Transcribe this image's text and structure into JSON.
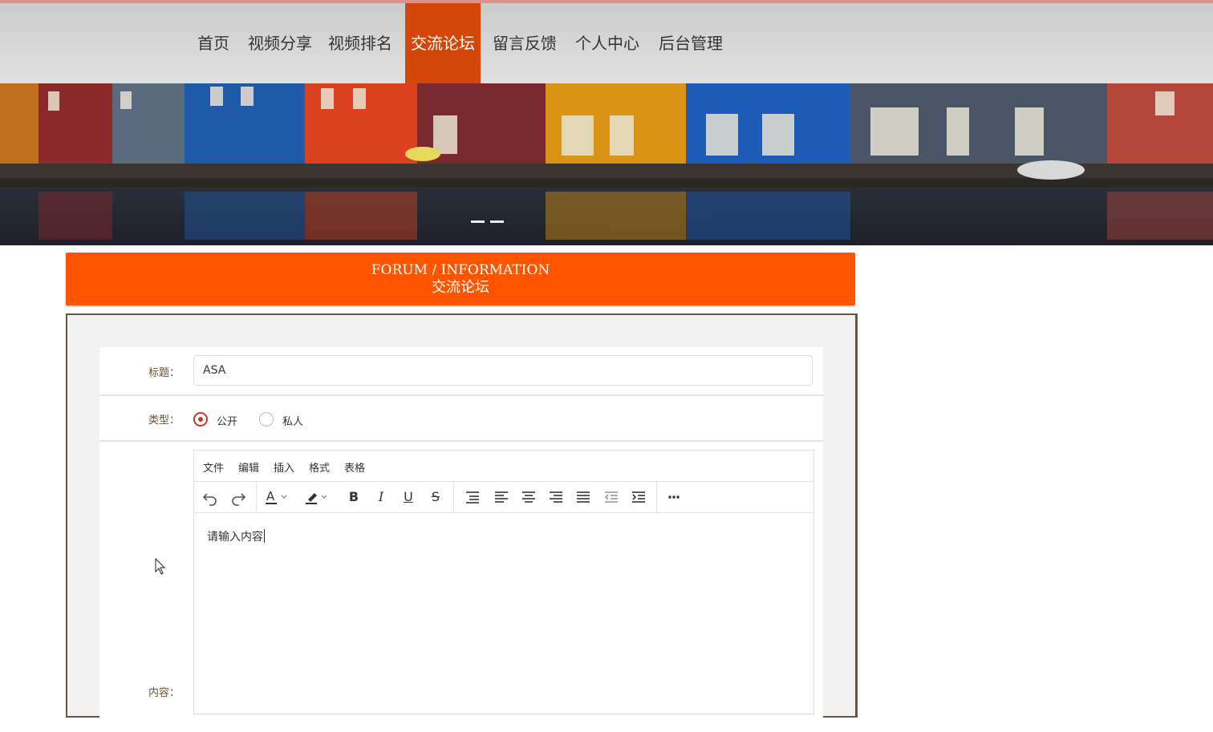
{
  "nav": {
    "items": [
      {
        "label": "首页"
      },
      {
        "label": "视频分享"
      },
      {
        "label": "视频排名"
      },
      {
        "label": "交流论坛"
      },
      {
        "label": "留言反馈"
      },
      {
        "label": "个人中心"
      },
      {
        "label": "后台管理"
      }
    ],
    "active_index": 3,
    "active_color": "#d4470b"
  },
  "banner": {
    "slide_count": 2,
    "active_slide": 1
  },
  "section": {
    "title_en": "FORUM / INFORMATION",
    "title_cn": "交流论坛",
    "accent_color": "#ff5500"
  },
  "form": {
    "title_label": "标题：",
    "title_value": "ASA",
    "type_label": "类型：",
    "type_options": [
      {
        "label": "公开",
        "checked": true
      },
      {
        "label": "私人",
        "checked": false
      }
    ],
    "content_label": "内容：",
    "editor": {
      "menu": [
        "文件",
        "编辑",
        "插入",
        "格式",
        "表格"
      ],
      "toolbar_icons": [
        "undo-icon",
        "redo-icon",
        "text-color-icon",
        "highlight-color-icon",
        "bold-icon",
        "italic-icon",
        "underline-icon",
        "strikethrough-icon",
        "line-height-icon",
        "align-left-icon",
        "align-center-icon",
        "align-right-icon",
        "align-justify-icon",
        "outdent-icon",
        "indent-icon",
        "more-icon"
      ],
      "content": "请输入内容"
    }
  }
}
